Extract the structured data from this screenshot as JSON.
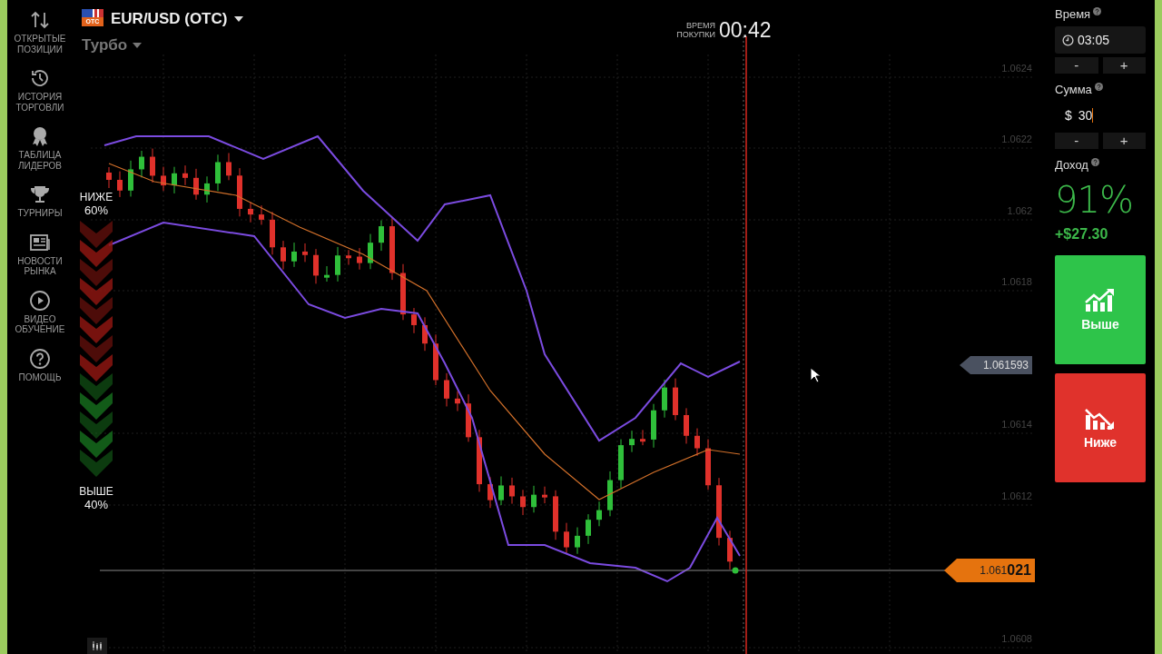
{
  "sidebar": {
    "items": [
      {
        "label": "ОТКРЫТЫЕ ПОЗИЦИИ"
      },
      {
        "label": "ИСТОРИЯ ТОРГОВЛИ"
      },
      {
        "label": "ТАБЛИЦА ЛИДЕРОВ"
      },
      {
        "label": "ТУРНИРЫ"
      },
      {
        "label": "НОВОСТИ РЫНКА"
      },
      {
        "label": "ВИДЕО ОБУЧЕНИЕ"
      },
      {
        "label": "ПОМОЩЬ"
      }
    ]
  },
  "asset": {
    "flag_badge": "OTC",
    "name": "EUR/USD (OTC)"
  },
  "mode": "Турбо",
  "purchase_timer": {
    "label": "ВРЕМЯ ПОКУПКИ",
    "value": "00:42"
  },
  "sentiment": {
    "down_label": "НИЖЕ",
    "down_share": "60%",
    "up_label": "ВЫШЕ",
    "up_share": "40%",
    "level": 0.6
  },
  "price_axis": [
    "1.0624",
    "1.0622",
    "1.062",
    "1.0618",
    "1.0614",
    "1.0612",
    "1.0608"
  ],
  "price_tags": [
    {
      "kind": "marker",
      "text": "1.061593"
    },
    {
      "kind": "current",
      "text": "1.061**021**"
    }
  ],
  "trade_panel": {
    "time": {
      "label": "Время",
      "value": "03:05",
      "minus": "-",
      "plus": "+"
    },
    "amount": {
      "label": "Сумма",
      "currency": "$",
      "value": "30",
      "minus": "-",
      "plus": "+"
    },
    "payout": {
      "label": "Доход",
      "percent": "91%",
      "profit": "+$27.30"
    },
    "buttons": [
      {
        "kind": "up",
        "label": "Выше"
      },
      {
        "kind": "down",
        "label": "Ниже"
      }
    ]
  }
}
